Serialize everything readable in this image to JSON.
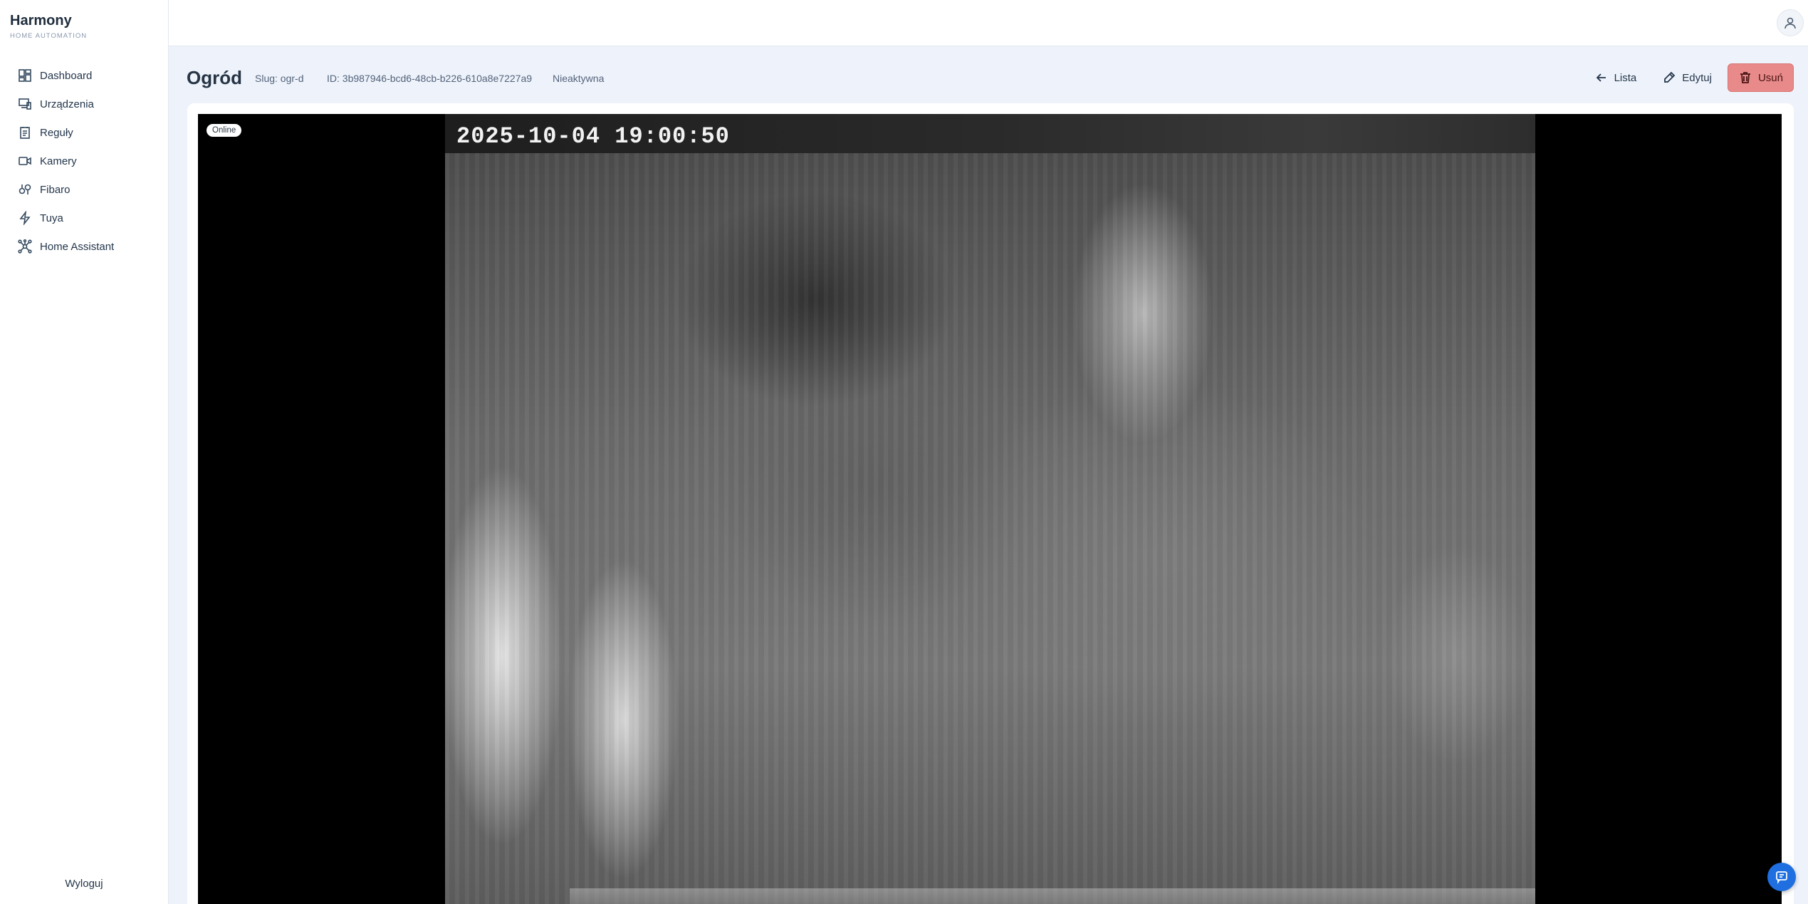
{
  "brand": {
    "title": "Harmony",
    "subtitle": "HOME AUTOMATION"
  },
  "sidebar": {
    "items": [
      {
        "label": "Dashboard",
        "icon": "dashboard-icon"
      },
      {
        "label": "Urządzenia",
        "icon": "devices-icon"
      },
      {
        "label": "Reguły",
        "icon": "rules-icon"
      },
      {
        "label": "Kamery",
        "icon": "camera-icon"
      },
      {
        "label": "Fibaro",
        "icon": "fibaro-icon"
      },
      {
        "label": "Tuya",
        "icon": "lightning-icon"
      },
      {
        "label": "Home Assistant",
        "icon": "network-icon"
      }
    ],
    "logout_label": "Wyloguj"
  },
  "topbar": {
    "user_icon": "user-icon"
  },
  "header": {
    "title": "Ogród",
    "slug": "Slug: ogr-d",
    "id": "ID: 3b987946-bcd6-48cb-b226-610a8e7227a9",
    "status": "Nieaktywna"
  },
  "actions": {
    "list_label": "Lista",
    "edit_label": "Edytuj",
    "delete_label": "Usuń"
  },
  "camera": {
    "badge": "Online",
    "timestamp": "2025-10-04 19:00:50"
  },
  "colors": {
    "accent": "#1f6fe0",
    "danger": "#e88a8a",
    "background": "#eef3fb"
  }
}
